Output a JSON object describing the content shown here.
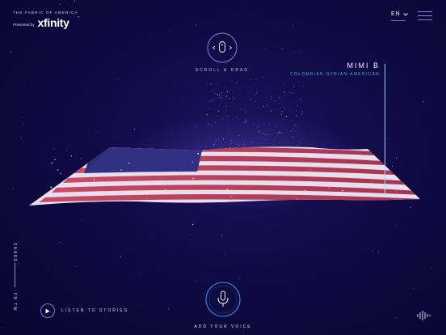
{
  "brand": {
    "tagline": "THE FABRIC OF AMERICA",
    "presented": "Presented by",
    "logo": "xfinity"
  },
  "nav": {
    "language": "EN"
  },
  "scroll": {
    "label": "SCROLL & DRAG"
  },
  "person": {
    "name": "MIMI B",
    "origin": "COLOMBIAN-SYRIAN-AMERICAN"
  },
  "share": {
    "label": "SHARE",
    "networks": "FB TW"
  },
  "listen": {
    "label": "LISTEN TO STORIES"
  },
  "voice": {
    "label": "ADD YOUR VOICE"
  },
  "colors": {
    "background": "#0c0838",
    "accent": "#4aa9e6",
    "flag_red": "#c0405a",
    "flag_white": "#e8e0ee",
    "flag_blue": "#2c2a76"
  },
  "icons": {
    "language_caret": "chevron-down-icon",
    "menu": "hamburger-icon",
    "scroll": "mouse-icon",
    "listen": "play-icon",
    "voice": "microphone-icon",
    "audio": "sound-wave-icon"
  }
}
